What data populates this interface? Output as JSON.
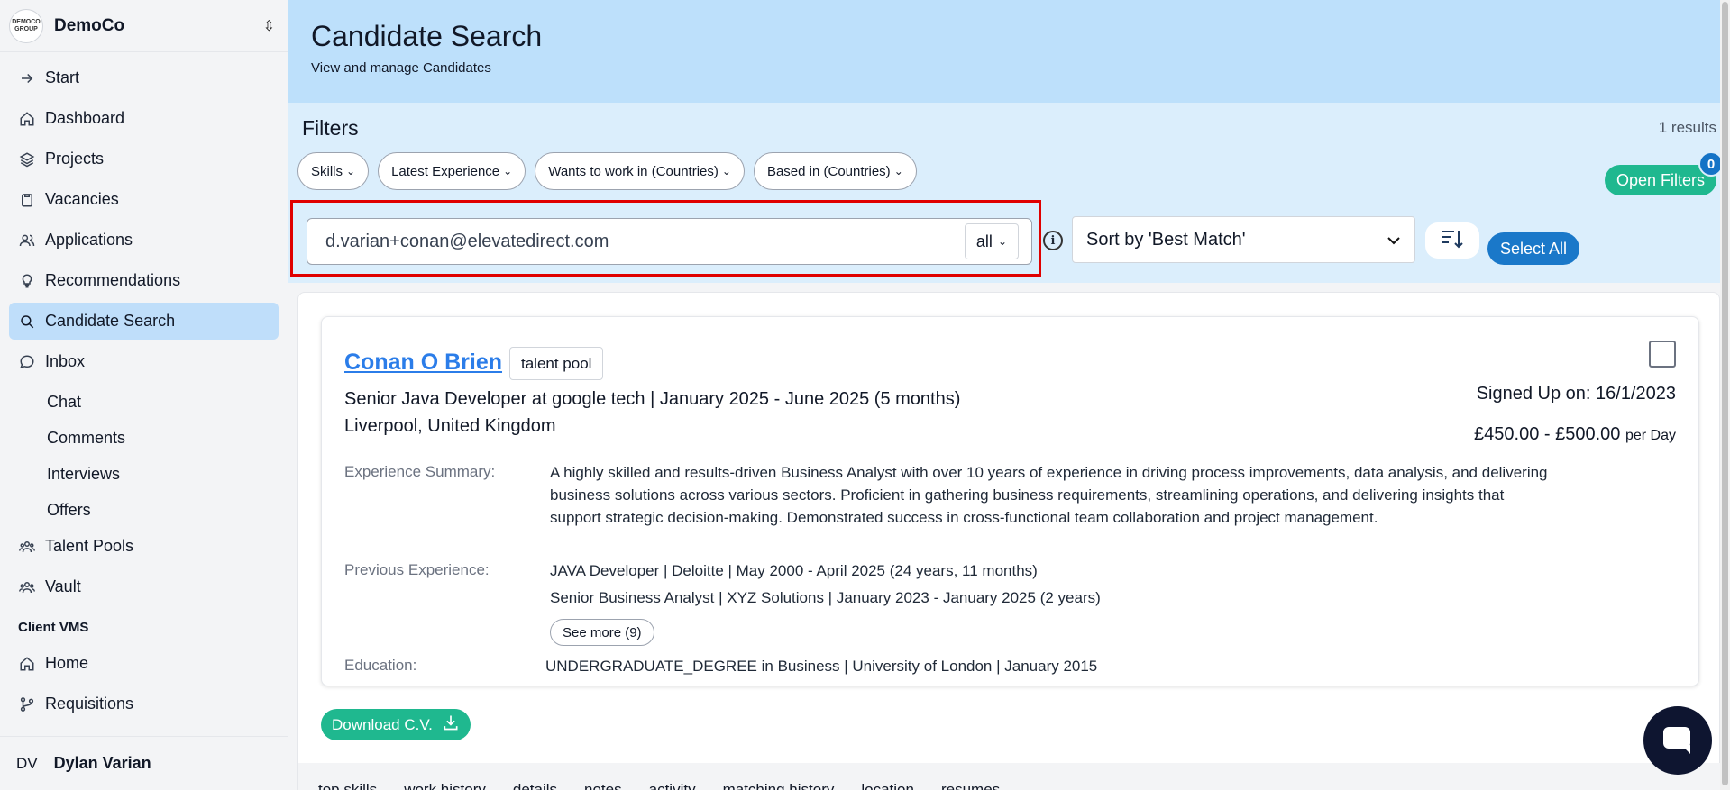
{
  "org": {
    "logo_text": "DEMOCO GROUP",
    "name": "DemoCo"
  },
  "sidebar": {
    "items": [
      {
        "label": "Start"
      },
      {
        "label": "Dashboard"
      },
      {
        "label": "Projects"
      },
      {
        "label": "Vacancies"
      },
      {
        "label": "Applications"
      },
      {
        "label": "Recommendations"
      },
      {
        "label": "Candidate Search"
      },
      {
        "label": "Inbox"
      }
    ],
    "inbox_sub": [
      "Chat",
      "Comments",
      "Interviews",
      "Offers"
    ],
    "items2": [
      {
        "label": "Talent Pools"
      },
      {
        "label": "Vault"
      }
    ],
    "section": "Client VMS",
    "items3": [
      {
        "label": "Home"
      },
      {
        "label": "Requisitions"
      }
    ],
    "user": {
      "initials": "DV",
      "name": "Dylan Varian"
    }
  },
  "header": {
    "title": "Candidate Search",
    "subtitle": "View and manage Candidates"
  },
  "filters": {
    "title": "Filters",
    "results": "1 results",
    "chips": [
      "Skills",
      "Latest Experience",
      "Wants to work in (Countries)",
      "Based in (Countries)"
    ],
    "open_filters": "Open Filters",
    "open_filters_count": "0",
    "search_value": "d.varian+conan@elevatedirect.com",
    "scope": "all",
    "sort": "Sort by 'Best Match'",
    "select_all": "Select All"
  },
  "candidate": {
    "name": "Conan O Brien",
    "tag": "talent pool",
    "role": "Senior Java Developer at google tech | January 2025 - June 2025 (5 months)",
    "location": "Liverpool, United Kingdom",
    "signed_up": "Signed Up on: 16/1/2023",
    "rate": "£450.00 - £500.00",
    "rate_unit": "per Day",
    "summary_label": "Experience Summary:",
    "summary": "A highly skilled and results-driven Business Analyst with over 10 years of experience in driving process improvements, data analysis, and delivering business solutions across various sectors. Proficient in gathering business requirements, streamlining operations, and delivering insights that support strategic decision-making. Demonstrated success in cross-functional team collaboration and project management.",
    "prev_label": "Previous Experience:",
    "prev": [
      "JAVA Developer | Deloitte | May 2000 - April 2025 (24 years, 11 months)",
      "Senior Business Analyst | XYZ Solutions | January 2023 - January 2025 (2 years)"
    ],
    "see_more": "See more (9)",
    "edu_label": "Education:",
    "education": "UNDERGRADUATE_DEGREE in Business | University of London | January 2015",
    "download": "Download C.V."
  },
  "tabs": [
    "top skills",
    "work history",
    "details",
    "notes",
    "activity",
    "matching history",
    "location",
    "resumes"
  ],
  "colors": {
    "accent_green": "#1fb88f",
    "accent_blue": "#1a78c9",
    "header_bg": "#bde0fb",
    "highlight_red": "#e00000"
  }
}
